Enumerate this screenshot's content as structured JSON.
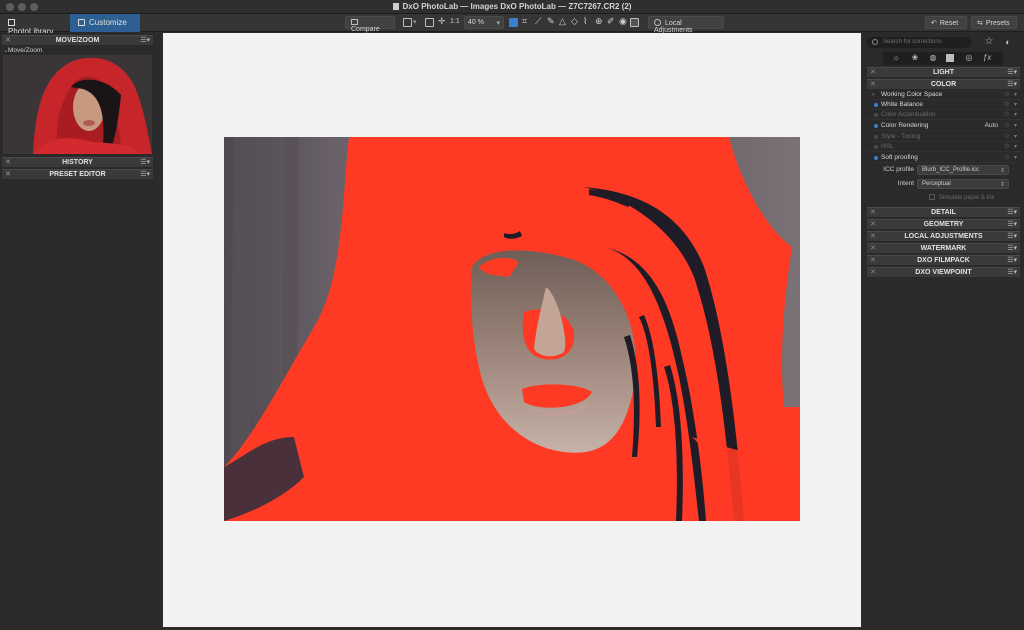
{
  "window": {
    "title": "DxO PhotoLab — Images DxO PhotoLab — Z7C7267.CR2 (2)"
  },
  "toolbar": {
    "tabs": [
      {
        "label": "PhotoLibrary"
      },
      {
        "label": "Customize",
        "active": true
      }
    ],
    "compare_label": "Compare",
    "zoom_fit_label": "1:1",
    "zoom_value": "40 %",
    "local_adjustments_label": "Local Adjustments",
    "reset_label": "Reset",
    "presets_label": "Presets"
  },
  "left_panel": {
    "move_zoom_header": "MOVE/ZOOM",
    "move_zoom_sub": "Move/Zoom",
    "history_header": "HISTORY",
    "preset_editor_header": "PRESET EDITOR"
  },
  "right_panel": {
    "search_placeholder": "Search for corrections",
    "sections": {
      "light": "LIGHT",
      "color": "COLOR",
      "detail": "DETAIL",
      "geometry": "GEOMETRY",
      "local_adjustments": "LOCAL ADJUSTMENTS",
      "watermark": "WATERMARK",
      "filmpack": "DXO FILMPACK",
      "viewpoint": "DXO VIEWPOINT"
    },
    "color_rows": [
      {
        "label": "Working Color Space",
        "enabled": false,
        "dim": false
      },
      {
        "label": "White Balance",
        "enabled": true,
        "dim": false
      },
      {
        "label": "Color Accentuation",
        "enabled": false,
        "dim": true
      },
      {
        "label": "Color Rendering",
        "enabled": true,
        "dim": false,
        "value": "Auto"
      },
      {
        "label": "Style - Toning",
        "enabled": false,
        "dim": true
      },
      {
        "label": "HSL",
        "enabled": false,
        "dim": true
      },
      {
        "label": "Soft proofing",
        "enabled": true,
        "dim": false
      }
    ],
    "soft_proofing": {
      "icc_label": "ICC profile",
      "icc_value": "Blurb_ICC_Profile.icc",
      "intent_label": "Intent",
      "intent_value": "Perceptual",
      "simulate_label": "Simulate paper & ink"
    }
  },
  "colors": {
    "accent": "#2d5f92",
    "overlay_red": "#ff3a24",
    "canvas_bg": "#f2f2f2"
  }
}
